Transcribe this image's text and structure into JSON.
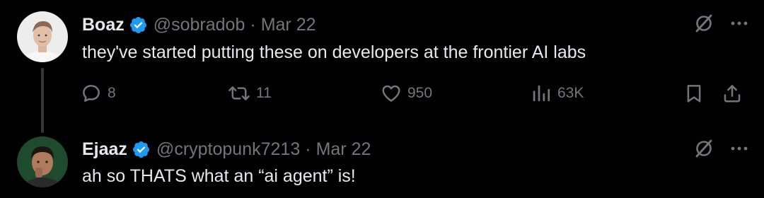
{
  "tweets": [
    {
      "author": {
        "name": "Boaz",
        "handle": "@sobradob",
        "verified": true
      },
      "separator": "·",
      "date": "Mar 22",
      "text": "they've started putting these on developers at the frontier AI labs",
      "metrics": {
        "replies": "8",
        "retweets": "11",
        "likes": "950",
        "views": "63K"
      }
    },
    {
      "author": {
        "name": "Ejaaz",
        "handle": "@cryptopunk7213",
        "verified": true
      },
      "separator": "·",
      "date": "Mar 22",
      "text": "ah so THATS what an “ai agent” is!"
    }
  ],
  "colors": {
    "background": "#000000",
    "primary_text": "#e7e9ea",
    "secondary_text": "#71767b",
    "verified_blue": "#1d9bf0",
    "thread_line": "#333639"
  },
  "icons": {
    "reply": "reply-icon",
    "retweet": "retweet-icon",
    "like": "heart-icon",
    "views": "views-icon",
    "bookmark": "bookmark-icon",
    "share": "share-icon",
    "more": "more-icon",
    "grok": "grok-icon",
    "verified": "verified-badge-icon"
  }
}
